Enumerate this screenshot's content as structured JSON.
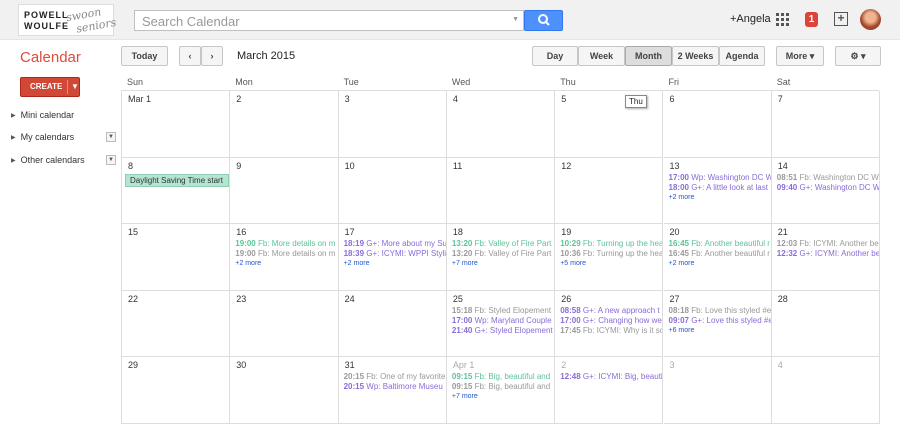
{
  "logo": {
    "line1": "POWELL",
    "line2": "WOULFE",
    "script1": "swoon",
    "script2": "seniors"
  },
  "search": {
    "placeholder": "Search Calendar"
  },
  "user": {
    "name": "+Angela",
    "notifications": "1"
  },
  "app": {
    "title": "Calendar",
    "create_label": "CREATE"
  },
  "toolbar": {
    "today": "Today",
    "month_title": "March 2015",
    "views": [
      "Day",
      "Week",
      "Month",
      "2 Weeks",
      "Agenda"
    ],
    "selected_view": "Month",
    "more": "More ▾",
    "settings": "⚙ ▾"
  },
  "sidebar": {
    "items": [
      {
        "label": "Mini calendar"
      },
      {
        "label": "My calendars"
      },
      {
        "label": "Other calendars"
      }
    ]
  },
  "weekdays": [
    "Sun",
    "Mon",
    "Tue",
    "Wed",
    "Thu",
    "Fri",
    "Sat"
  ],
  "tooltip": "Thu",
  "colors": {
    "accent": "#dd4b39",
    "blue": "#4d90fe",
    "event_green": "#5dc298",
    "event_purple": "#8a6bd8",
    "event_gray": "#999999",
    "more_link": "#2255cc"
  },
  "weeks": [
    [
      {
        "day": "Mar 1",
        "events": []
      },
      {
        "day": "2",
        "events": []
      },
      {
        "day": "3",
        "events": []
      },
      {
        "day": "4",
        "events": []
      },
      {
        "day": "5",
        "events": []
      },
      {
        "day": "6",
        "events": []
      },
      {
        "day": "7",
        "events": []
      }
    ],
    [
      {
        "day": "8",
        "allday": "Daylight Saving Time start",
        "events": []
      },
      {
        "day": "9",
        "events": []
      },
      {
        "day": "10",
        "events": []
      },
      {
        "day": "11",
        "events": []
      },
      {
        "day": "12",
        "events": []
      },
      {
        "day": "13",
        "events": [
          {
            "time": "17:00",
            "text": "Wp: Washington DC W",
            "color": "purple"
          },
          {
            "time": "18:00",
            "text": "G+: A little look at last",
            "color": "purple"
          }
        ],
        "more": "+2 more"
      },
      {
        "day": "14",
        "events": [
          {
            "time": "08:51",
            "text": "Fb: Washington DC W",
            "color": "gray"
          },
          {
            "time": "09:40",
            "text": "G+: Washington DC W",
            "color": "purple"
          }
        ]
      }
    ],
    [
      {
        "day": "15",
        "events": []
      },
      {
        "day": "16",
        "events": [
          {
            "time": "19:00",
            "text": "Fb: More details on m",
            "color": "green"
          },
          {
            "time": "19:00",
            "text": "Fb: More details on m",
            "color": "gray"
          }
        ],
        "more": "+2 more"
      },
      {
        "day": "17",
        "events": [
          {
            "time": "18:19",
            "text": "G+: More about my Su",
            "color": "purple"
          },
          {
            "time": "18:39",
            "text": "G+: ICYMI: WPPI Styli",
            "color": "purple"
          }
        ],
        "more": "+2 more"
      },
      {
        "day": "18",
        "events": [
          {
            "time": "13:20",
            "text": "Fb: Valley of Fire Part",
            "color": "green"
          },
          {
            "time": "13:20",
            "text": "Fb: Valley of Fire Part",
            "color": "gray"
          }
        ],
        "more": "+7 more"
      },
      {
        "day": "19",
        "events": [
          {
            "time": "10:29",
            "text": "Fb: Turning up the hea",
            "color": "green"
          },
          {
            "time": "10:36",
            "text": "Fb: Turning up the hea",
            "color": "gray"
          }
        ],
        "more": "+5 more"
      },
      {
        "day": "20",
        "events": [
          {
            "time": "16:45",
            "text": "Fb: Another beautiful r",
            "color": "green"
          },
          {
            "time": "16:45",
            "text": "Fb: Another beautiful r",
            "color": "gray"
          }
        ],
        "more": "+2 more"
      },
      {
        "day": "21",
        "events": [
          {
            "time": "12:03",
            "text": "Fb: ICYMI: Another be",
            "color": "gray"
          },
          {
            "time": "12:32",
            "text": "G+: ICYMI: Another be",
            "color": "purple"
          }
        ]
      }
    ],
    [
      {
        "day": "22",
        "events": []
      },
      {
        "day": "23",
        "events": []
      },
      {
        "day": "24",
        "events": []
      },
      {
        "day": "25",
        "events": [
          {
            "time": "15:18",
            "text": "Fb: Styled Elopement",
            "color": "gray"
          },
          {
            "time": "17:00",
            "text": "Wp: Maryland Couple",
            "color": "purple"
          },
          {
            "time": "21:40",
            "text": "G+: Styled Elopement",
            "color": "purple"
          }
        ]
      },
      {
        "day": "26",
        "events": [
          {
            "time": "08:58",
            "text": "G+: A new approach t",
            "color": "purple"
          },
          {
            "time": "17:00",
            "text": "G+: Changing how we",
            "color": "purple"
          },
          {
            "time": "17:45",
            "text": "Fb: ICYMI: Why is it sc",
            "color": "gray"
          }
        ]
      },
      {
        "day": "27",
        "events": [
          {
            "time": "08:18",
            "text": "Fb: Love this styled #e",
            "color": "gray"
          },
          {
            "time": "09:07",
            "text": "G+: Love this styled #e",
            "color": "purple"
          }
        ],
        "more": "+6 more"
      },
      {
        "day": "28",
        "events": []
      }
    ],
    [
      {
        "day": "29",
        "events": []
      },
      {
        "day": "30",
        "events": []
      },
      {
        "day": "31",
        "events": [
          {
            "time": "20:15",
            "text": "Fb: One of my favorite",
            "color": "gray"
          },
          {
            "time": "20:15",
            "text": "Wp: Baltimore Museu",
            "color": "purple"
          }
        ]
      },
      {
        "day": "Apr 1",
        "other": true,
        "events": [
          {
            "time": "09:15",
            "text": "Fb: Big, beautiful and",
            "color": "green"
          },
          {
            "time": "09:15",
            "text": "Fb: Big, beautiful and",
            "color": "gray"
          }
        ],
        "more": "+7 more"
      },
      {
        "day": "2",
        "other": true,
        "events": [
          {
            "time": "12:48",
            "text": "G+: ICYMI: Big, beauti",
            "color": "purple"
          }
        ]
      },
      {
        "day": "3",
        "other": true,
        "events": []
      },
      {
        "day": "4",
        "other": true,
        "events": []
      }
    ]
  ]
}
